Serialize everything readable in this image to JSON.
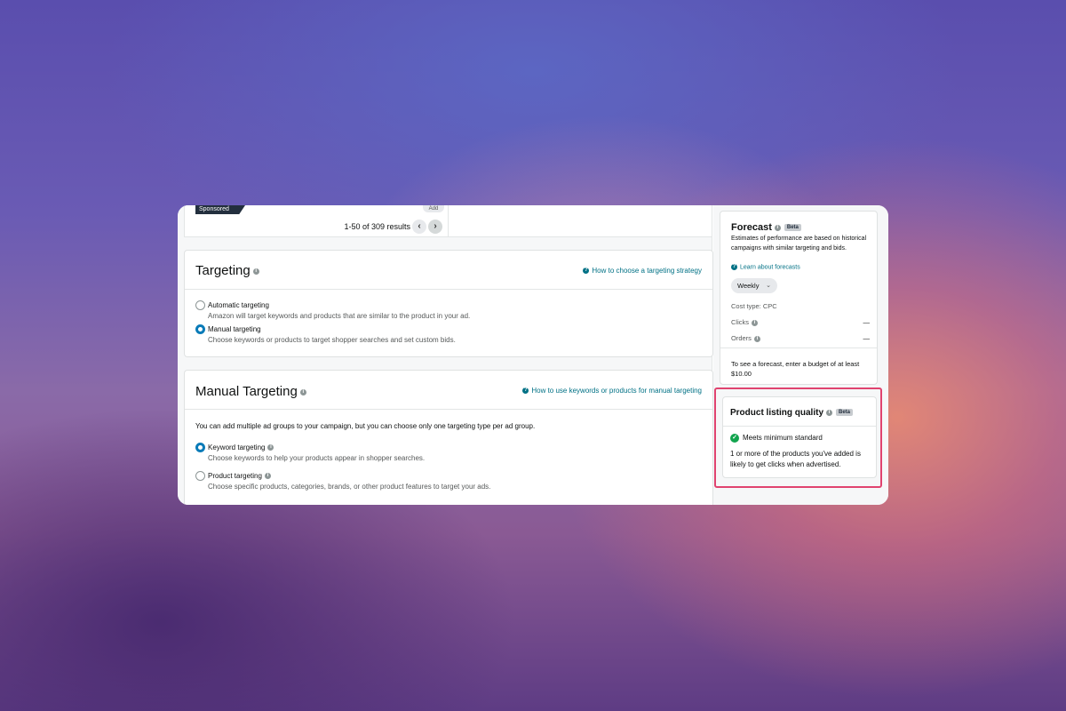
{
  "results": {
    "sponsored_tag": "Sponsored",
    "add_label": "Add",
    "count": "1-50 of 309 results"
  },
  "targeting": {
    "title": "Targeting",
    "help_link": "How to choose a targeting strategy",
    "options": [
      {
        "label": "Automatic targeting",
        "desc": "Amazon will target keywords and products that are similar to the product in your ad.",
        "selected": false
      },
      {
        "label": "Manual targeting",
        "desc": "Choose keywords or products to target shopper searches and set custom bids.",
        "selected": true
      }
    ]
  },
  "manual_targeting": {
    "title": "Manual Targeting",
    "help_link": "How to use keywords or products for manual targeting",
    "intro": "You can add multiple ad groups to your campaign, but you can choose only one targeting type per ad group.",
    "options": [
      {
        "label": "Keyword targeting",
        "desc": "Choose keywords to help your products appear in shopper searches.",
        "selected": true
      },
      {
        "label": "Product targeting",
        "desc": "Choose specific products, categories, brands, or other product features to target your ads.",
        "selected": false
      }
    ]
  },
  "forecast": {
    "title": "Forecast",
    "badge": "Beta",
    "description": "Estimates of performance are based on historical campaigns with similar targeting and bids.",
    "learn_link": "Learn about forecasts",
    "period": "Weekly",
    "cost_type": "Cost type: CPC",
    "metrics": [
      {
        "label": "Clicks",
        "value": "—"
      },
      {
        "label": "Orders",
        "value": "—"
      }
    ],
    "note": "To see a forecast, enter a budget of at least $10.00"
  },
  "listing_quality": {
    "title": "Product listing quality",
    "badge": "Beta",
    "status": "Meets minimum standard",
    "description": "1 or more of the products you've added is likely to get clicks when advertised."
  }
}
